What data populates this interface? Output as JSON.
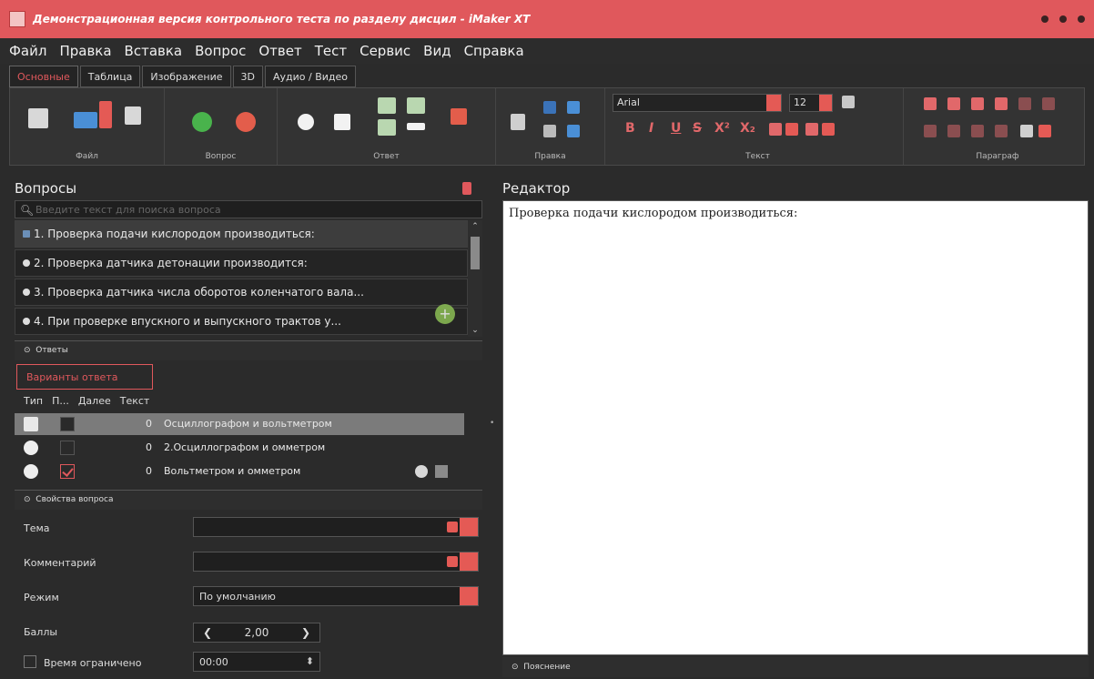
{
  "window": {
    "title": "Демонстрационная версия контрольного теста по разделу дисцил - iMaker XT"
  },
  "menu": [
    "Файл",
    "Правка",
    "Вставка",
    "Вопрос",
    "Ответ",
    "Тест",
    "Сервис",
    "Вид",
    "Справка"
  ],
  "tabs": [
    "Основные",
    "Таблица",
    "Изображение",
    "3D",
    "Аудио / Видео"
  ],
  "ribbon": {
    "groups": [
      "Файл",
      "Вопрос",
      "Ответ",
      "Правка",
      "Текст",
      "Параграф"
    ],
    "font": "Arial",
    "font_size": "12",
    "format_buttons": [
      "B",
      "I",
      "U",
      "S",
      "X²",
      "X₂"
    ]
  },
  "questions_panel": {
    "title": "Вопросы",
    "search_placeholder": "Введите текст для поиска вопроса",
    "items": [
      "1. Проверка подачи кислородом производиться:",
      "2. Проверка датчика детонации производится:",
      "3. Проверка датчика числа оборотов коленчатого вала...",
      "4. При проверке впускного и выпускного трактов у..."
    ]
  },
  "answers": {
    "section": "Ответы",
    "subtab": "Варианты ответа",
    "columns": [
      "Тип",
      "П...",
      "Далее",
      "Текст"
    ],
    "rows": [
      {
        "next": "0",
        "text": "Осциллографом и вольтметром"
      },
      {
        "next": "0",
        "text": "2.Осциллографом и омметром"
      },
      {
        "next": "0",
        "text": "Вольтметром и омметром"
      }
    ]
  },
  "properties": {
    "section": "Свойства вопроса",
    "topic_label": "Тема",
    "comment_label": "Комментарий",
    "mode_label": "Режим",
    "mode_value": "По умолчанию",
    "score_label": "Баллы",
    "score_value": "2,00",
    "time_label": "Время ограничено",
    "time_value": "00:00"
  },
  "editor": {
    "title": "Редактор",
    "text": "Проверка подачи кислородом производиться:",
    "hint_label": "Пояснение"
  },
  "colors": {
    "accent": "#e0585c",
    "background": "#2b2b2b"
  }
}
